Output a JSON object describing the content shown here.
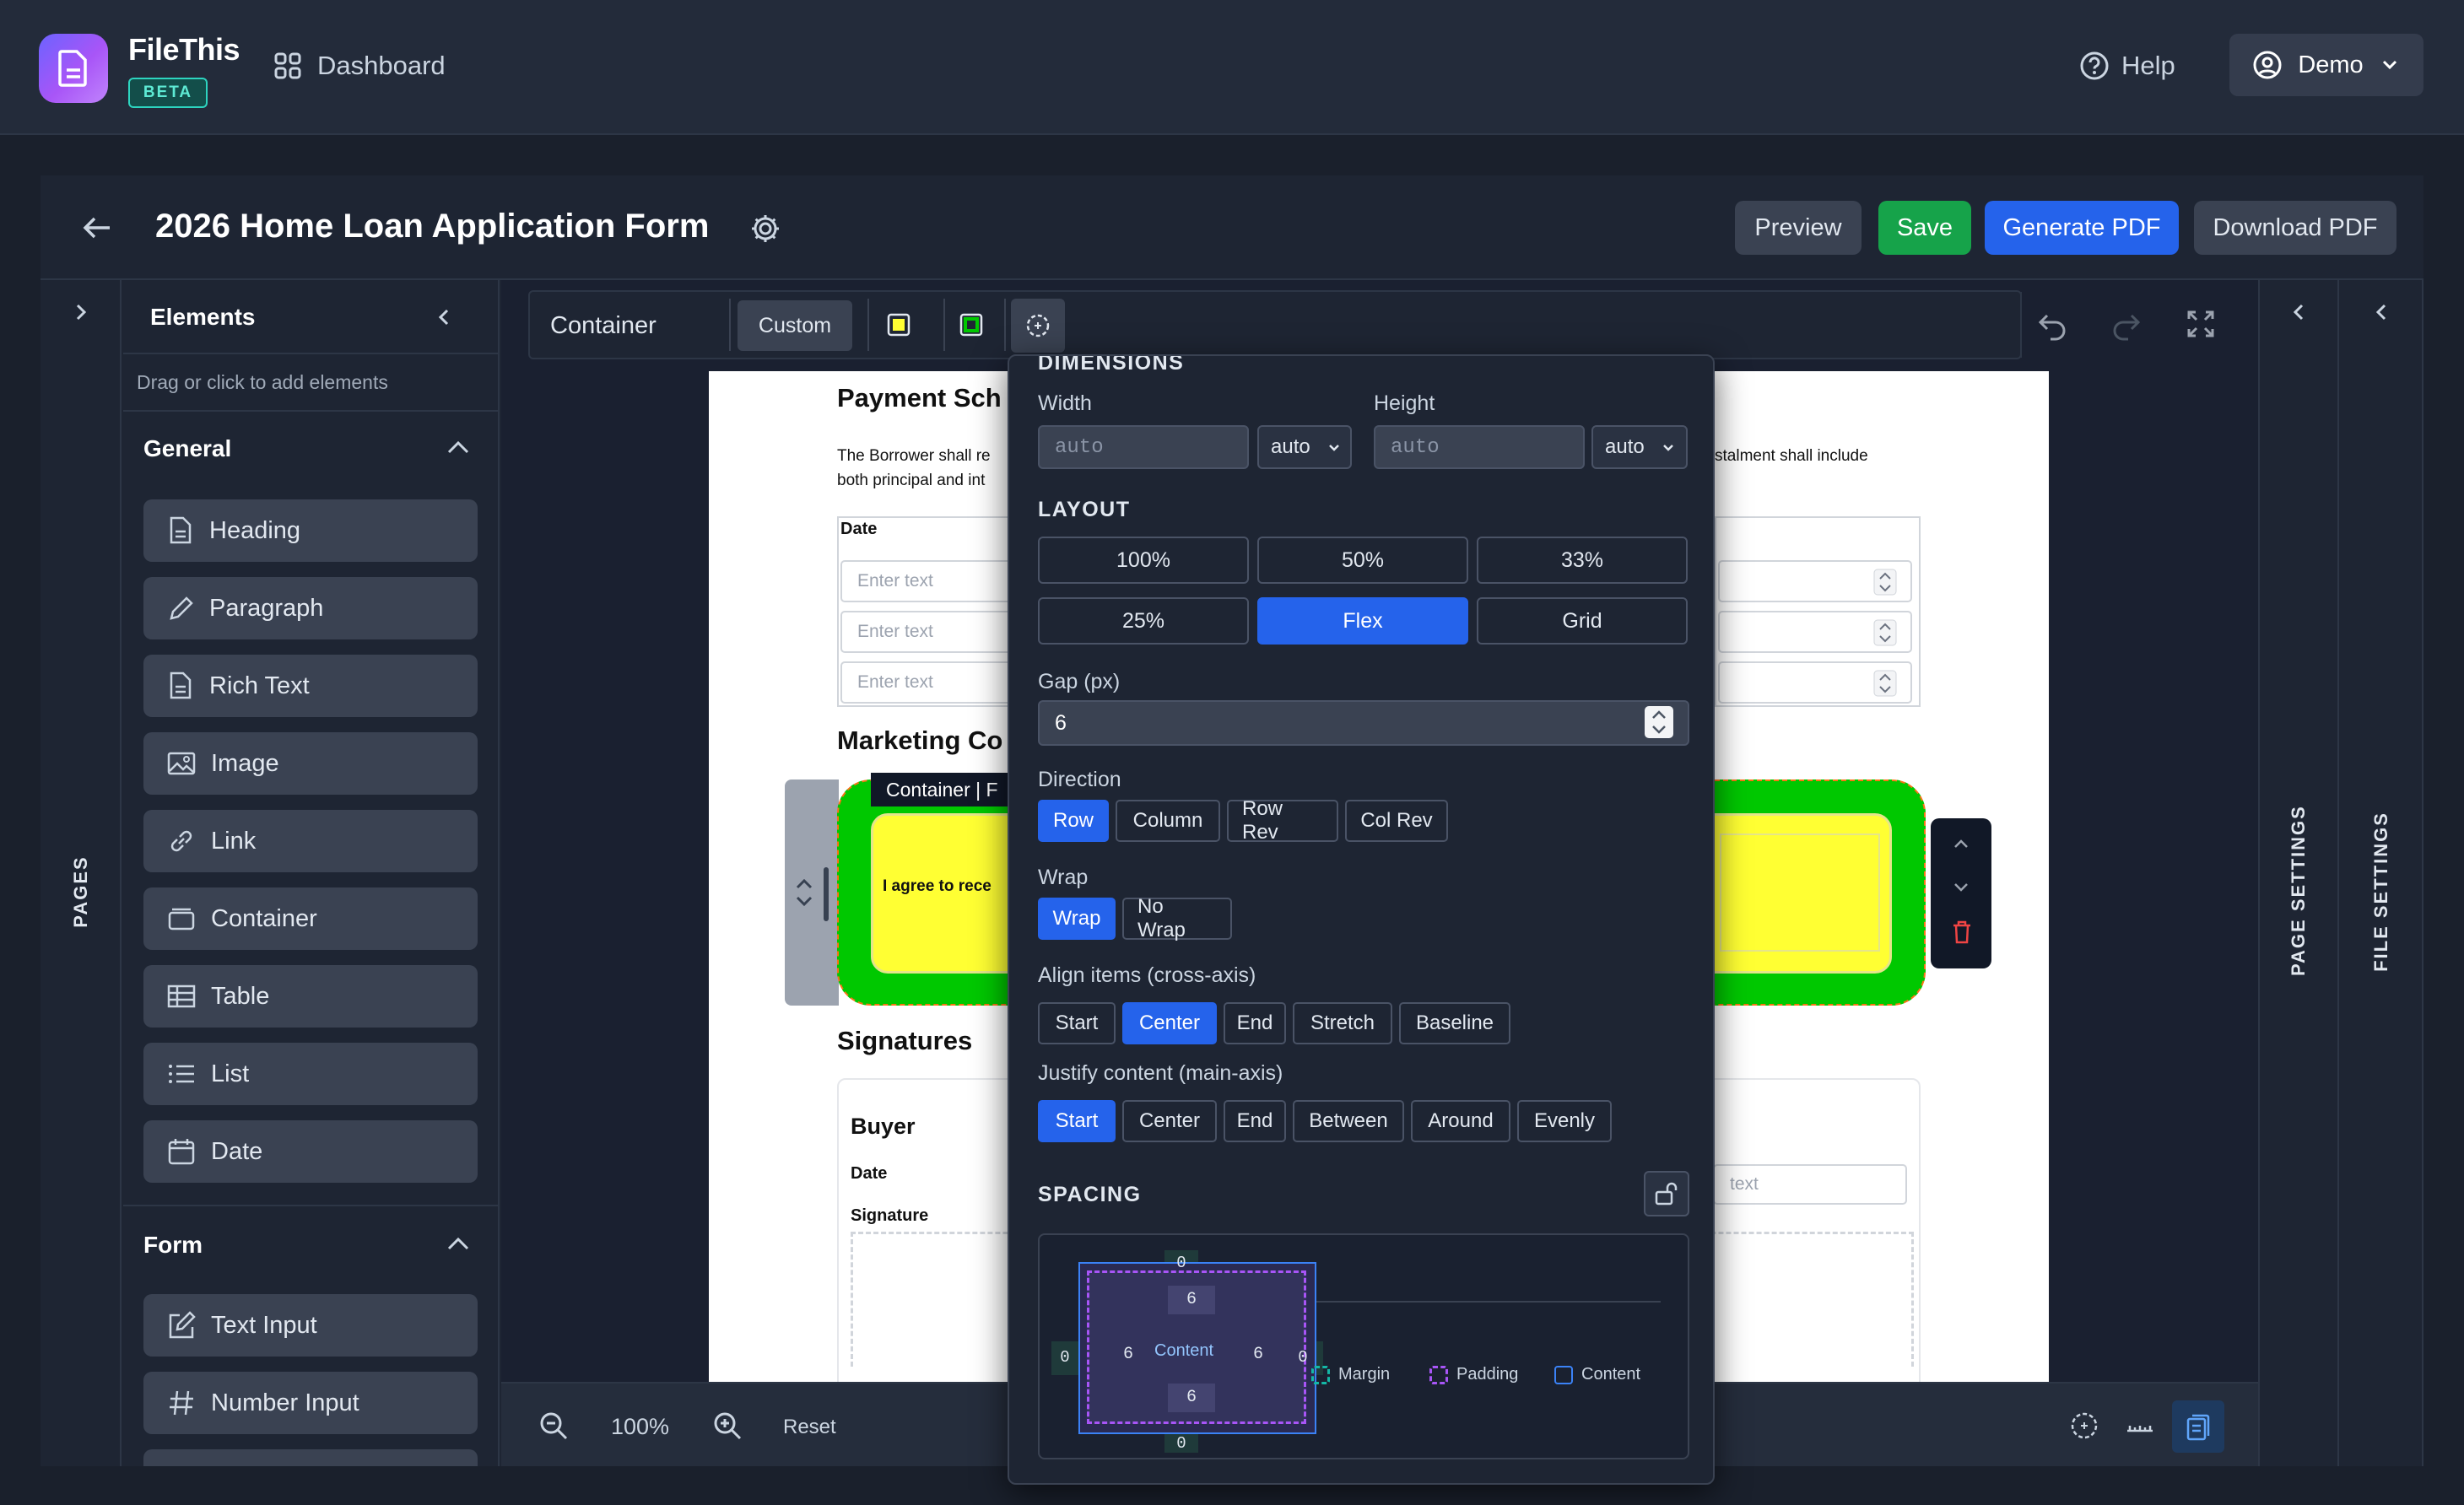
{
  "header": {
    "app_name": "FileThis",
    "badge": "BETA",
    "nav_dashboard": "Dashboard",
    "help": "Help",
    "user": "Demo"
  },
  "titlebar": {
    "title": "2026 Home Loan Application Form",
    "preview": "Preview",
    "save": "Save",
    "generate": "Generate PDF",
    "download": "Download PDF"
  },
  "side": {
    "pages": "PAGES",
    "page_settings": "PAGE SETTINGS",
    "file_settings": "FILE SETTINGS"
  },
  "elements": {
    "title": "Elements",
    "hint": "Drag or click to add elements",
    "general_label": "General",
    "general": [
      "Heading",
      "Paragraph",
      "Rich Text",
      "Image",
      "Link",
      "Container",
      "Table",
      "List",
      "Date"
    ],
    "form_label": "Form",
    "form": [
      "Text Input",
      "Number Input"
    ]
  },
  "toolbar": {
    "element_type": "Container",
    "custom": "Custom"
  },
  "document": {
    "section1": "Payment Sch",
    "para_left": "The Borrower shall re",
    "para_left2": "both principal and int",
    "para_right": "stalment shall include",
    "date_label": "Date",
    "placeholder": "Enter text",
    "section2": "Marketing Co",
    "container_tag": "Container | F",
    "consent": "I agree to rece",
    "section3": "Signatures",
    "buyer": "Buyer",
    "sig_date": "Date",
    "signature": "Signature",
    "text_ph": "text"
  },
  "popover": {
    "dimensions": "DIMENSIONS",
    "width_label": "Width",
    "height_label": "Height",
    "width_value": "auto",
    "height_value": "auto",
    "width_unit": "auto",
    "height_unit": "auto",
    "layout": "LAYOUT",
    "layout_options": [
      "100%",
      "50%",
      "33%",
      "25%",
      "Flex",
      "Grid"
    ],
    "layout_selected": "Flex",
    "gap_label": "Gap (px)",
    "gap_value": "6",
    "direction_label": "Direction",
    "direction": [
      "Row",
      "Column",
      "Row Rev",
      "Col Rev"
    ],
    "wrap_label": "Wrap",
    "wrap": [
      "Wrap",
      "No Wrap"
    ],
    "align_label": "Align items (cross-axis)",
    "align": [
      "Start",
      "Center",
      "End",
      "Stretch",
      "Baseline"
    ],
    "justify_label": "Justify content (main-axis)",
    "justify": [
      "Start",
      "Center",
      "End",
      "Between",
      "Around",
      "Evenly"
    ],
    "spacing": "SPACING",
    "box": {
      "margin_top": "0",
      "margin_bottom": "0",
      "margin_left": "0",
      "margin_right": "0",
      "padding_top": "6",
      "padding_bottom": "6",
      "padding_left": "6",
      "padding_right": "6",
      "content": "Content"
    },
    "legend": [
      "Margin",
      "Padding",
      "Content"
    ]
  },
  "bottombar": {
    "zoom": "100%",
    "reset": "Reset"
  },
  "colors": {
    "accent": "#2563eb",
    "save_green": "#16a34a",
    "highlight_green": "#00c800",
    "highlight_yellow": "#ffff33"
  }
}
